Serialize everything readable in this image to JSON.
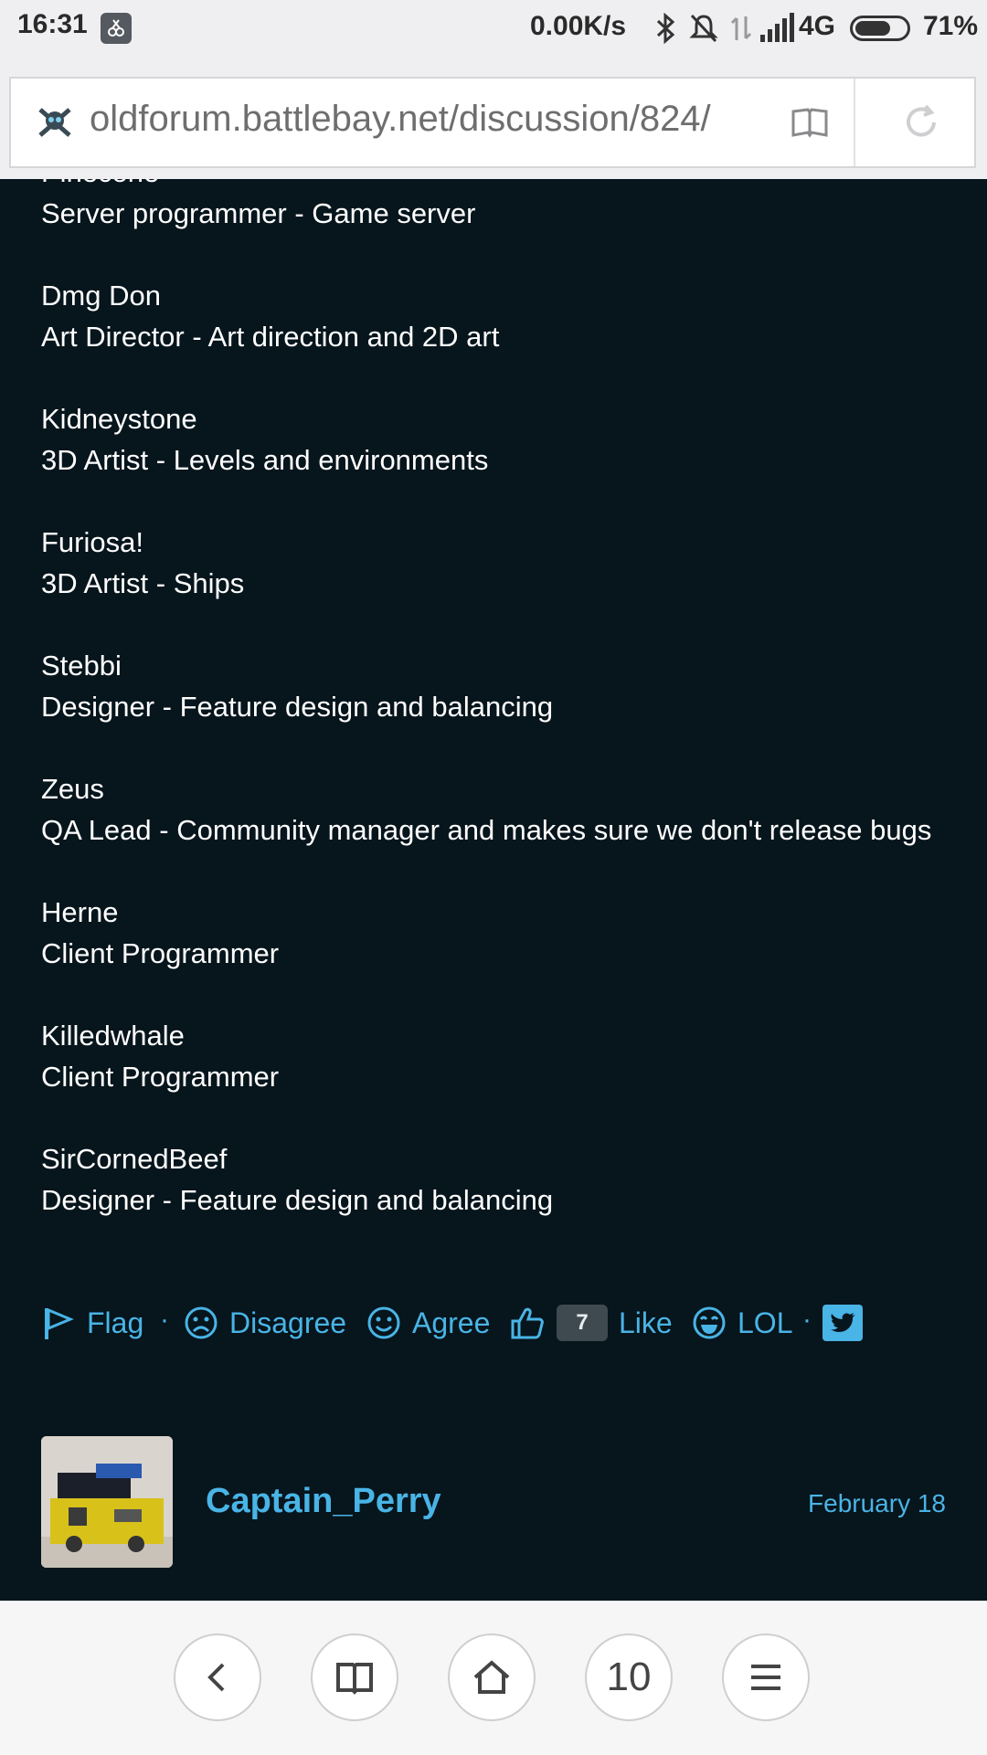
{
  "status_bar": {
    "time": "16:31",
    "speed": "0.00K/s",
    "network": "4G",
    "battery_pct": "71%",
    "battery_level": 0.71
  },
  "browser": {
    "url": "oldforum.battlebay.net/discussion/824/"
  },
  "post": {
    "cut_off_line": "Pinecone",
    "entries": [
      {
        "name": "",
        "role": "Server programmer - Game server"
      },
      {
        "name": "Dmg Don",
        "role": "Art Director - Art direction and 2D art"
      },
      {
        "name": "Kidneystone",
        "role": "3D Artist - Levels and environments"
      },
      {
        "name": "Furiosa!",
        "role": "3D Artist - Ships"
      },
      {
        "name": "Stebbi",
        "role": "Designer - Feature design and balancing"
      },
      {
        "name": "Zeus",
        "role": "QA Lead - Community manager and makes sure we don't release bugs"
      },
      {
        "name": "Herne",
        "role": "Client Programmer"
      },
      {
        "name": "Killedwhale",
        "role": "Client Programmer"
      },
      {
        "name": "SirCornedBeef",
        "role": "Designer - Feature design and balancing"
      }
    ]
  },
  "reactions": {
    "flag": "Flag",
    "disagree": "Disagree",
    "agree": "Agree",
    "like_count": "7",
    "like": "Like",
    "lol": "LOL",
    "separator": "·"
  },
  "comment": {
    "username": "Captain_Perry",
    "date": "February 18"
  },
  "bottom_nav": {
    "tab_count": "10"
  },
  "colors": {
    "background": "#07151c",
    "accent": "#49b4e6"
  }
}
